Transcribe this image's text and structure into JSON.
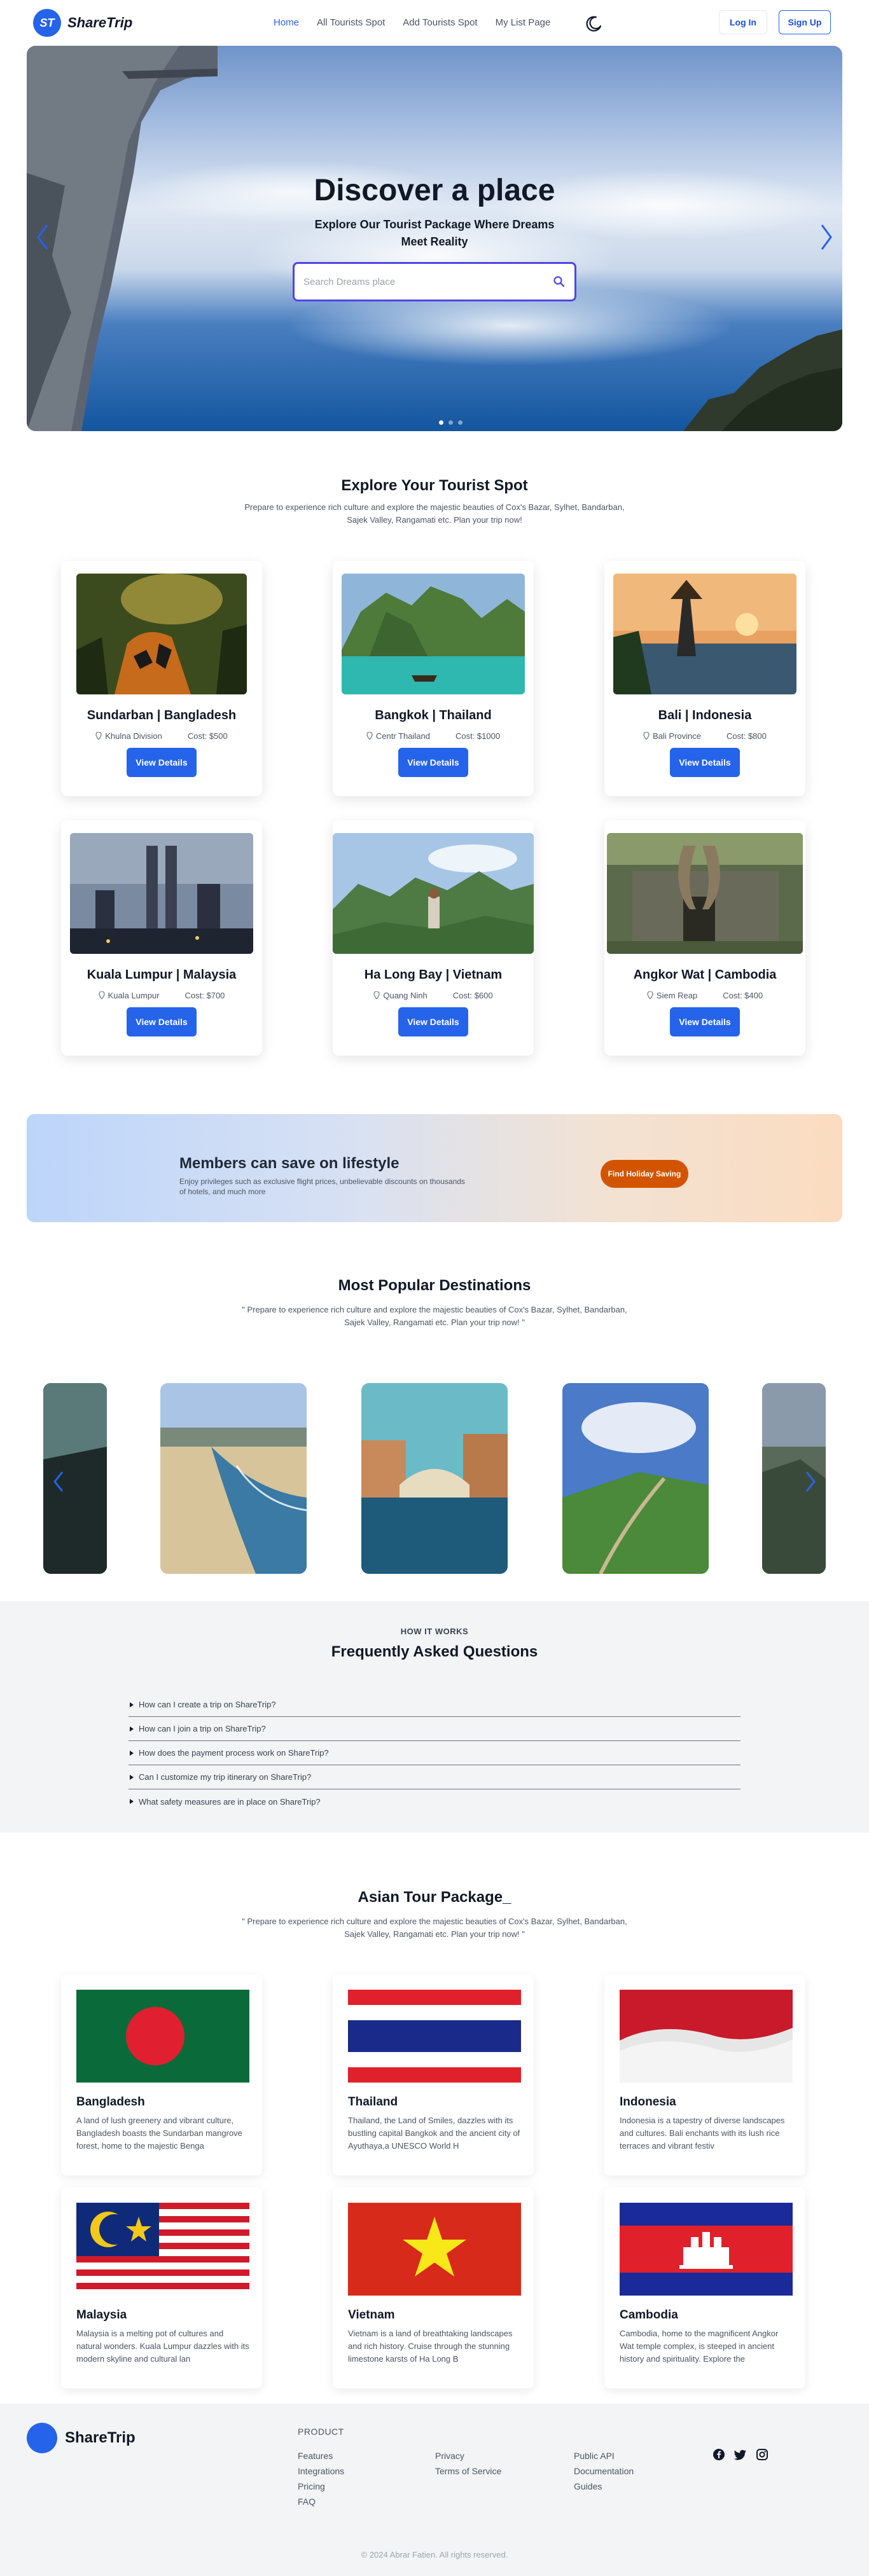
{
  "nav": {
    "brand": "ShareTrip",
    "logo_mark": "ST",
    "links": [
      "Home",
      "All Tourists Spot",
      "Add Tourists Spot",
      "My List Page"
    ],
    "theme_icon": "moon-icon",
    "login": "Log In",
    "signup": "Sign Up"
  },
  "hero": {
    "title": "Discover a place",
    "subtitle": "Explore Our Tourist Package Where Dreams Meet Reality",
    "search_placeholder": "Search Dreams place"
  },
  "spots": {
    "title": "Explore Your Tourist Spot",
    "desc": "Prepare to experience rich culture and explore the majestic beauties of Cox's Bazar, Sylhet, Bandarban, Sajek Valley, Rangamati etc. Plan your trip now!",
    "button": "View Details",
    "items": [
      {
        "name": "Sundarban | Bangladesh",
        "location": "Khulna Division",
        "cost": "Cost: $500"
      },
      {
        "name": "Bangkok | Thailand",
        "location": "Centr Thailand",
        "cost": "Cost: $1000"
      },
      {
        "name": "Bali | Indonesia",
        "location": "Bali Province",
        "cost": "Cost: $800"
      },
      {
        "name": "Kuala Lumpur | Malaysia",
        "location": "Kuala Lumpur",
        "cost": "Cost: $700"
      },
      {
        "name": "Ha Long Bay | Vietnam",
        "location": "Quang Ninh",
        "cost": "Cost: $600"
      },
      {
        "name": "Angkor Wat | Cambodia",
        "location": "Siem Reap",
        "cost": "Cost: $400"
      }
    ]
  },
  "banner": {
    "title": "Members can save on lifestyle",
    "desc": "Enjoy privileges such as exclusive flight prices, unbelievable discounts on thousands of hotels, and much more",
    "button": "Find Holiday Saving"
  },
  "popular": {
    "title": "Most Popular Destinations",
    "desc": "\" Prepare to experience rich culture and explore the majestic beauties of Cox's Bazar, Sylhet, Bandarban, Sajek Valley, Rangamati etc. Plan your trip now! \""
  },
  "faq": {
    "eyebrow": "HOW IT WORKS",
    "title": "Frequently Asked Questions",
    "items": [
      "How can I create a trip on ShareTrip?",
      "How can I join a trip on ShareTrip?",
      "How does the payment process work on ShareTrip?",
      "Can I customize my trip itinerary on ShareTrip?",
      "What safety measures are in place on ShareTrip?"
    ]
  },
  "tour": {
    "title": "Asian Tour Package_",
    "desc": "\" Prepare to experience rich culture and explore the majestic beauties of Cox's Bazar, Sylhet, Bandarban, Sajek Valley, Rangamati etc. Plan your trip now! \"",
    "items": [
      {
        "name": "Bangladesh",
        "desc": "A land of lush greenery and vibrant culture, Bangladesh boasts the Sundarban mangrove forest, home to the majestic Benga"
      },
      {
        "name": "Thailand",
        "desc": "Thailand, the Land of Smiles, dazzles with its bustling capital Bangkok and the ancient city of Ayuthaya,a UNESCO World H"
      },
      {
        "name": "Indonesia",
        "desc": "Indonesia is a tapestry of diverse landscapes and cultures. Bali enchants with its lush rice terraces and vibrant festiv"
      },
      {
        "name": "Malaysia",
        "desc": "Malaysia is a melting pot of cultures and natural wonders. Kuala Lumpur dazzles with its modern skyline and cultural lan"
      },
      {
        "name": "Vietnam",
        "desc": "Vietnam is a land of breathtaking landscapes and rich history. Cruise through the stunning limestone karsts of Ha Long B"
      },
      {
        "name": "Cambodia",
        "desc": "Cambodia, home to the magnificent Angkor Wat temple complex, is steeped in ancient history and spirituality. Explore the"
      }
    ]
  },
  "footer": {
    "brand": "ShareTrip",
    "heading": "PRODUCT",
    "col1": [
      "Features",
      "Integrations",
      "Pricing",
      "FAQ"
    ],
    "col2": [
      "Privacy",
      "Terms of Service"
    ],
    "col3": [
      "Public API",
      "Documentation",
      "Guides"
    ],
    "social": [
      "facebook-icon",
      "twitter-icon",
      "instagram-icon"
    ],
    "copyright": "© 2024 Abrar Fatien. All rights reserved."
  },
  "colors": {
    "primary": "#2563eb",
    "accent_orange": "#d35400",
    "search_border": "#4f46e5"
  }
}
